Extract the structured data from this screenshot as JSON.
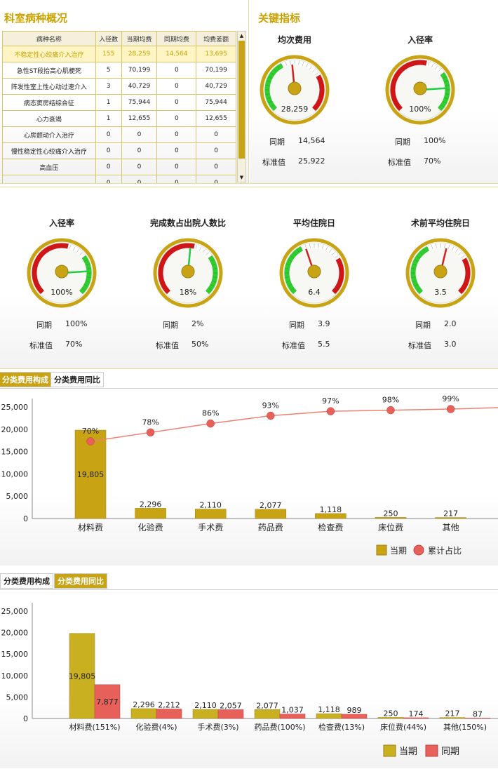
{
  "overview": {
    "title": "科室病种概况",
    "columns": [
      "病种名称",
      "入径数",
      "当期均费",
      "同期均费",
      "均费差额"
    ],
    "rows": [
      [
        "不稳定性心绞痛介入治疗",
        "155",
        "28,259",
        "14,564",
        "13,695"
      ],
      [
        "急性ST段抬高心肌梗死",
        "5",
        "70,199",
        "0",
        "70,199"
      ],
      [
        "阵发性室上性心动过速介入",
        "3",
        "40,729",
        "0",
        "40,729"
      ],
      [
        "病态窦房结综合征",
        "1",
        "75,944",
        "0",
        "75,944"
      ],
      [
        "心力衰竭",
        "1",
        "12,655",
        "0",
        "12,655"
      ],
      [
        "心房颤动介入治疗",
        "0",
        "0",
        "0",
        "0"
      ],
      [
        "慢性稳定性心绞痛介入治疗",
        "0",
        "0",
        "0",
        "0"
      ],
      [
        "高血压",
        "0",
        "0",
        "0",
        "0"
      ],
      [
        "",
        "0",
        "0",
        "0",
        "0"
      ]
    ]
  },
  "key_indicators": {
    "title": "关键指标",
    "same_period_label": "同期",
    "standard_label": "标准值",
    "gauges": [
      {
        "title": "均次费用",
        "value": "28,259",
        "same": "14,564",
        "standard": "25,922",
        "needle_fraction": 0.48,
        "mode": "cost"
      },
      {
        "title": "入径率",
        "value": "100%",
        "same": "100%",
        "standard": "70%",
        "needle_fraction": 0.82,
        "mode": "rate"
      }
    ]
  },
  "middle_gauges": [
    {
      "title": "入径率",
      "value": "100%",
      "same": "100%",
      "standard": "70%",
      "needle_fraction": 0.82,
      "mode": "rate"
    },
    {
      "title": "完成数占出院人数比",
      "value": "18%",
      "same": "2%",
      "standard": "50%",
      "needle_fraction": 0.52,
      "mode": "rate"
    },
    {
      "title": "平均住院日",
      "value": "6.4",
      "same": "3.9",
      "standard": "5.5",
      "needle_fraction": 0.43,
      "mode": "cost"
    },
    {
      "title": "术前平均住院日",
      "value": "3.5",
      "same": "2.0",
      "standard": "3.0",
      "needle_fraction": 0.55,
      "mode": "cost"
    }
  ],
  "tabs": {
    "composition": "分类费用构成",
    "comparison": "分类费用同比"
  },
  "colors": {
    "gold": "#c8a415",
    "red": "#e8605a",
    "line": "#f08070"
  },
  "chart_data": [
    {
      "type": "bar",
      "categories": [
        "材料费",
        "化验费",
        "手术费",
        "药品费",
        "检查费",
        "床位费",
        "其他"
      ],
      "series": [
        {
          "name": "当期",
          "values": [
            19805,
            2296,
            2110,
            2077,
            1118,
            250,
            217
          ]
        },
        {
          "name": "累计占比",
          "type": "line",
          "values": [
            70,
            78,
            86,
            93,
            97,
            98,
            99
          ]
        }
      ],
      "value_labels": [
        "19,805",
        "2,296",
        "2,110",
        "2,077",
        "1,118",
        "250",
        "217"
      ],
      "pct_labels": [
        "70%",
        "78%",
        "86%",
        "93%",
        "97%",
        "98%",
        "99%"
      ],
      "yticks": [
        "0",
        "5,000",
        "10,000",
        "15,000",
        "20,000",
        "25,000"
      ],
      "ylim": [
        0,
        25000
      ],
      "legend": [
        "当期",
        "累计占比"
      ],
      "legend_position": "bottom-right"
    },
    {
      "type": "bar",
      "categories": [
        "材料费(151%)",
        "化验费(4%)",
        "手术费(3%)",
        "药品费(100%)",
        "检查费(13%)",
        "床位费(44%)",
        "其他(150%)"
      ],
      "series": [
        {
          "name": "当期",
          "values": [
            19805,
            2296,
            2110,
            2077,
            1118,
            250,
            217
          ]
        },
        {
          "name": "同期",
          "values": [
            7877,
            2212,
            2057,
            1037,
            989,
            174,
            87
          ]
        }
      ],
      "labels_cur": [
        "19,805",
        "2,296",
        "2,110",
        "2,077",
        "1,118",
        "250",
        "217"
      ],
      "labels_prev": [
        "7,877",
        "2,212",
        "2,057",
        "1,037",
        "989",
        "174",
        "87"
      ],
      "yticks": [
        "0",
        "5,000",
        "10,000",
        "15,000",
        "20,000",
        "25,000"
      ],
      "ylim": [
        0,
        25000
      ],
      "legend": [
        "当期",
        "同期"
      ],
      "legend_position": "bottom-right"
    }
  ]
}
